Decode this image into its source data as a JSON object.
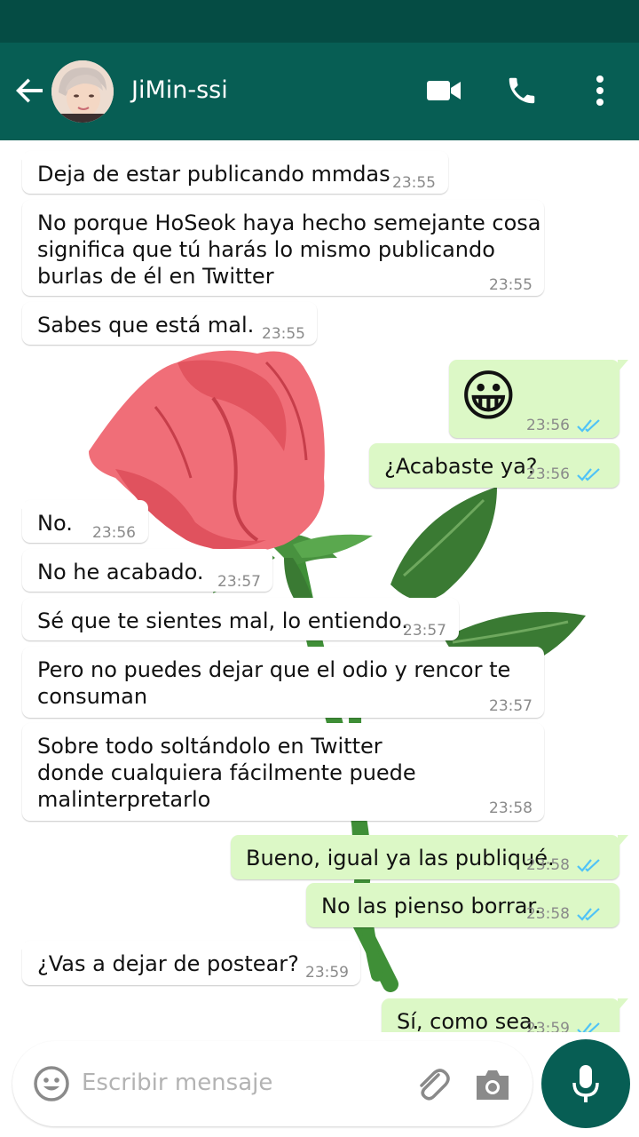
{
  "header": {
    "contact_name": "JiMin-ssi"
  },
  "colors": {
    "header": "#075e54",
    "status_bar": "#054c44",
    "outgoing_bubble": "#dcf8c6",
    "incoming_bubble": "#ffffff",
    "tick_read": "#4fc3f7"
  },
  "icons": {
    "back": "back-arrow-icon",
    "video": "video-call-icon",
    "call": "phone-icon",
    "menu": "more-vert-icon",
    "emoji": "emoji-icon",
    "attach": "paperclip-icon",
    "camera": "camera-icon",
    "mic": "mic-icon"
  },
  "messages": [
    {
      "dir": "in",
      "text": "Deja de estar publicando mmdas",
      "time": "23:55"
    },
    {
      "dir": "in",
      "text": "No porque HoSeok haya hecho semejante cosa\nsignifica que tú harás lo mismo publicando\nburlas de él en Twitter",
      "time": "23:55"
    },
    {
      "dir": "in",
      "text": "Sabes que está mal.",
      "time": "23:55"
    },
    {
      "dir": "out",
      "text": "😀",
      "time": "23:56",
      "read": true
    },
    {
      "dir": "out",
      "text": "¿Acabaste ya?",
      "time": "23:56",
      "read": true
    },
    {
      "dir": "in",
      "text": "No.",
      "time": "23:56"
    },
    {
      "dir": "in",
      "text": "No he acabado.",
      "time": "23:57"
    },
    {
      "dir": "in",
      "text": "Sé que te sientes mal, lo entiendo.",
      "time": "23:57"
    },
    {
      "dir": "in",
      "text": "Pero no puedes dejar que el odio y rencor te\nconsuman",
      "time": "23:57"
    },
    {
      "dir": "in",
      "text": "Sobre todo soltándolo en Twitter\ndonde cualquiera fácilmente puede\nmalinterpretarlo",
      "time": "23:58"
    },
    {
      "dir": "out",
      "text": "Bueno, igual ya las publiqué.",
      "time": "23:58",
      "read": true
    },
    {
      "dir": "out",
      "text": "No las pienso borrar.",
      "time": "23:58",
      "read": true
    },
    {
      "dir": "in",
      "text": "¿Vas a dejar de postear?",
      "time": "23:59"
    },
    {
      "dir": "out",
      "text": "Sí, como sea.",
      "time": "23:59",
      "read": true
    }
  ],
  "input": {
    "placeholder": "Escribir mensaje"
  }
}
